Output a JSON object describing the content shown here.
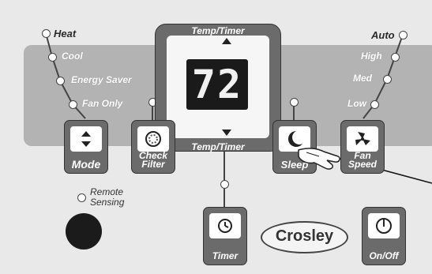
{
  "left_modes": [
    "Heat",
    "Cool",
    "Energy Saver",
    "Fan Only"
  ],
  "right_speeds": [
    "Auto",
    "High",
    "Med",
    "Low"
  ],
  "display": {
    "value": "72",
    "label_top": "Temp/Timer",
    "label_bottom": "Temp/Timer"
  },
  "buttons": {
    "mode": "Mode",
    "check_filter_line1": "Check",
    "check_filter_line2": "Filter",
    "sleep": "Sleep",
    "fan_speed_line1": "Fan",
    "fan_speed_line2": "Speed",
    "timer": "Timer",
    "onoff_line1": "On",
    "onoff_line2": "/Off"
  },
  "remote_sensing_line1": "Remote",
  "remote_sensing_line2": "Sensing",
  "brand": "Crosley",
  "icons": [
    "arrow-up-down-icon",
    "filter-icon",
    "moon-icon",
    "fan-icon",
    "timer-icon",
    "power-icon",
    "hand-pointer-icon"
  ]
}
